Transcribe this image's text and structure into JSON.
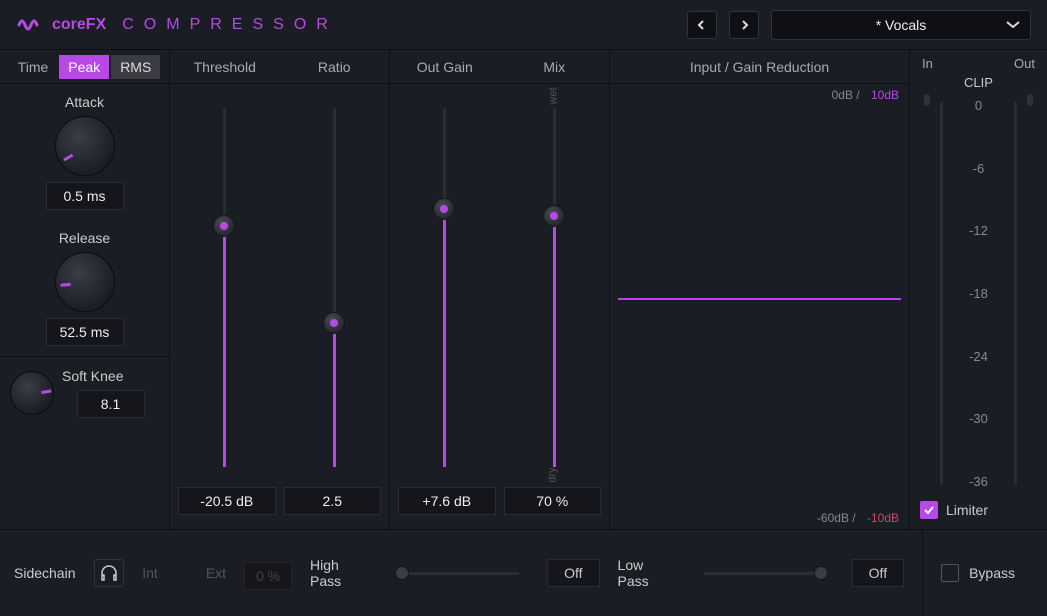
{
  "header": {
    "brand": "coreFX",
    "product": "COMPRESSOR",
    "preset": "* Vocals"
  },
  "detection": {
    "time_label": "Time",
    "peak_label": "Peak",
    "rms_label": "RMS",
    "attack_label": "Attack",
    "attack_value": "0.5 ms",
    "release_label": "Release",
    "release_value": "52.5 ms",
    "softknee_label": "Soft Knee",
    "softknee_value": "8.1"
  },
  "compress": {
    "threshold_label": "Threshold",
    "ratio_label": "Ratio",
    "threshold_value": "-20.5 dB",
    "ratio_value": "2.5"
  },
  "output": {
    "outgain_label": "Out Gain",
    "mix_label": "Mix",
    "outgain_value": "+7.6 dB",
    "mix_value": "70 %",
    "wet": "wet",
    "dry": "dry"
  },
  "graph": {
    "title": "Input / Gain Reduction",
    "top_in": "0dB /",
    "top_gr": "10dB",
    "bot_in": "-60dB /",
    "bot_gr": "-10dB"
  },
  "meter": {
    "in_label": "In",
    "out_label": "Out",
    "clip_label": "CLIP",
    "scale": [
      "0",
      "-6",
      "-12",
      "-18",
      "-24",
      "-30",
      "-36"
    ],
    "limiter_label": "Limiter"
  },
  "sidechain": {
    "label": "Sidechain",
    "int": "Int",
    "ext": "Ext",
    "pct": "0 %",
    "hp_label": "High Pass",
    "hp_value": "Off",
    "lp_label": "Low Pass",
    "lp_value": "Off",
    "bypass_label": "Bypass"
  }
}
